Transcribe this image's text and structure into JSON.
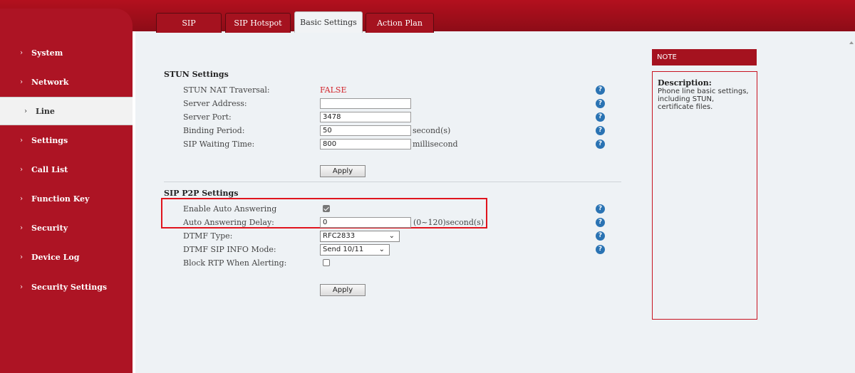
{
  "sidebar": {
    "items": [
      {
        "label": "System"
      },
      {
        "label": "Network"
      },
      {
        "label": "Line"
      },
      {
        "label": "Settings"
      },
      {
        "label": "Call List"
      },
      {
        "label": "Function Key"
      },
      {
        "label": "Security"
      },
      {
        "label": "Device Log"
      },
      {
        "label": "Security Settings"
      }
    ],
    "active": "Line"
  },
  "tabs": [
    {
      "label": "SIP"
    },
    {
      "label": "SIP Hotspot"
    },
    {
      "label": "Basic Settings"
    },
    {
      "label": "Action Plan"
    }
  ],
  "active_tab": "Basic Settings",
  "stun": {
    "title": "STUN Settings",
    "nat_traversal": {
      "label": "STUN NAT Traversal:",
      "value": "FALSE"
    },
    "server_address": {
      "label": "Server Address:",
      "value": ""
    },
    "server_port": {
      "label": "Server Port:",
      "value": "3478"
    },
    "binding_period": {
      "label": "Binding Period:",
      "value": "50",
      "unit": "second(s)"
    },
    "sip_waiting_time": {
      "label": "SIP Waiting Time:",
      "value": "800",
      "unit": "millisecond"
    },
    "apply_label": "Apply"
  },
  "p2p": {
    "title": "SIP P2P Settings",
    "auto_answer": {
      "label": "Enable Auto Answering",
      "checked": true
    },
    "auto_answer_delay": {
      "label": "Auto Answering Delay:",
      "value": "0",
      "unit": "(0~120)second(s)"
    },
    "dtmf_type": {
      "label": "DTMF Type:",
      "value": "RFC2833"
    },
    "dtmf_sip_info_mode": {
      "label": "DTMF SIP INFO Mode:",
      "value": "Send 10/11"
    },
    "block_rtp": {
      "label": "Block RTP When Alerting:",
      "checked": false
    },
    "apply_label": "Apply"
  },
  "note": {
    "header": "NOTE",
    "title": "Description:",
    "text": "Phone line basic settings, including STUN, certificate files."
  },
  "icons": {
    "help": "help-icon",
    "chevron": "chevron-right-icon",
    "dropdown": "chevron-down-icon"
  },
  "colors": {
    "brand_red": "#ad1424",
    "value_red": "#d2232a",
    "help_blue": "#2a73b3",
    "highlight": "#e0141d"
  }
}
